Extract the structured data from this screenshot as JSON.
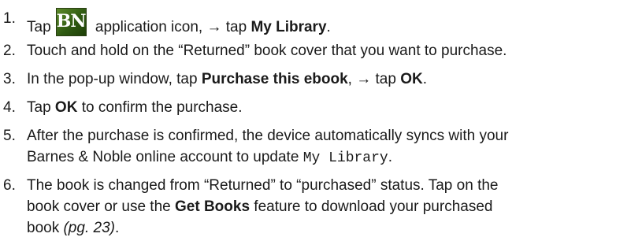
{
  "steps": [
    {
      "num": "1.",
      "parts": {
        "a": "Tap",
        "icon_label": "BN",
        "b": " application icon, → tap ",
        "c": "My Library",
        "d": "."
      }
    },
    {
      "num": "2.",
      "text": "Touch and hold on the “Returned” book cover that you want to purchase."
    },
    {
      "num": "3.",
      "parts": {
        "a": "In the pop-up window, tap ",
        "b": "Purchase this ebook",
        "c": ", → tap ",
        "d": "OK",
        "e": "."
      }
    },
    {
      "num": "4.",
      "parts": {
        "a": "Tap ",
        "b": "OK",
        "c": " to confirm the purchase."
      }
    },
    {
      "num": "5.",
      "line1": "After the purchase is confirmed, the device automatically syncs with your",
      "line2a": "Barnes & Noble online account to update ",
      "line2b": "My Library",
      "line2c": "."
    },
    {
      "num": "6.",
      "line1": "The book is changed from “Returned” to “purchased” status. Tap on the",
      "line2a": "book cover or use the ",
      "line2b": "Get Books",
      "line2c": " feature to download your purchased",
      "line3a": "book ",
      "line3b": "(pg. 23)",
      "line3c": "."
    }
  ],
  "icon": "barnes-noble-app-icon"
}
